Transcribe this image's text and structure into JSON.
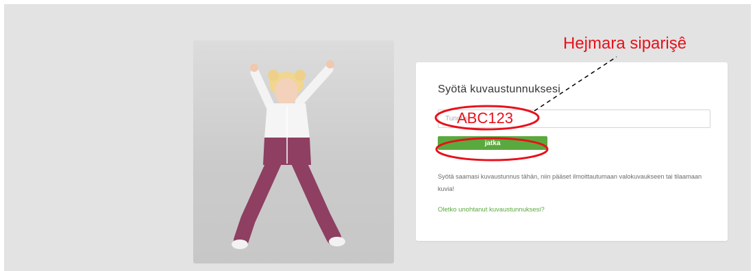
{
  "login": {
    "title": "Syötä kuvaustunnuksesi",
    "input_placeholder": "Tunnus",
    "submit_label": "jatka",
    "help_text": "Syötä saamasi kuvaustunnus tähän, niin pääset ilmoittautumaan valokuvaukseen tai tilaamaan kuvia!",
    "forgot_link": "Oletko unohtanut kuvaustunnuksesi?"
  },
  "annotations": {
    "label": "Hejmara siparişê",
    "example_code": "ABC123",
    "color": "#e8101b"
  },
  "colors": {
    "accent_green": "#5aa93e",
    "page_background": "#e3e3e3",
    "card_background": "#ffffff"
  }
}
